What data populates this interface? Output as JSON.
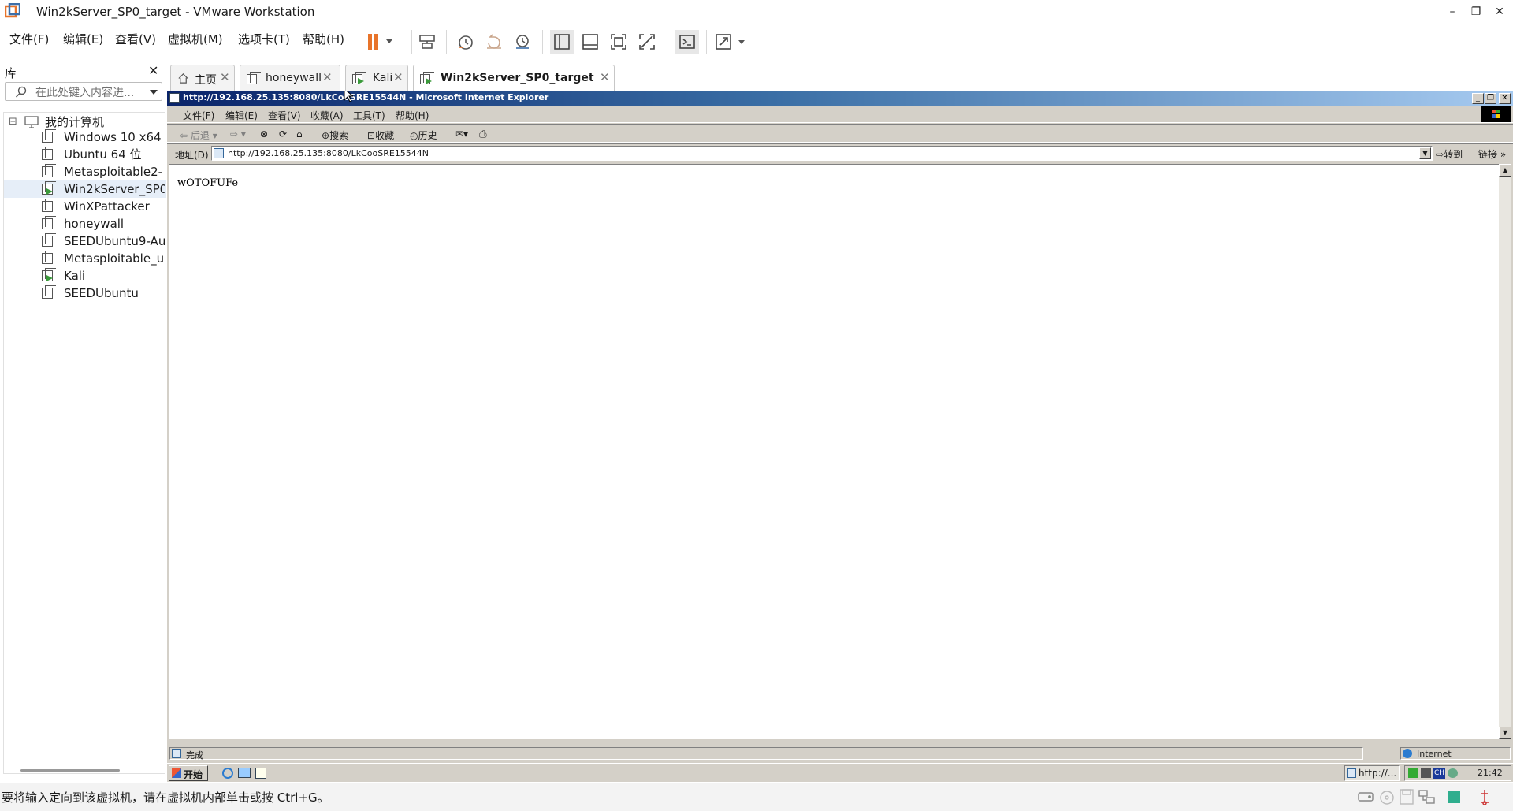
{
  "window": {
    "title": "Win2kServer_SP0_target - VMware Workstation",
    "minimize_symbol": "–",
    "restore_symbol": "❐",
    "close_symbol": "✕"
  },
  "menu": {
    "items": [
      "文件(F)",
      "编辑(E)",
      "查看(V)",
      "虚拟机(M)",
      "选项卡(T)",
      "帮助(H)"
    ]
  },
  "toolbar": {
    "icons": [
      "pause-icon",
      "send-ctrl-alt-del-icon",
      "snapshot-take-icon",
      "snapshot-revert-icon",
      "snapshot-manager-icon",
      "view-library-icon",
      "view-thumbnail-icon",
      "full-screen-icon",
      "unity-icon",
      "console-icon",
      "stretch-icon"
    ],
    "accent_color": "#e8742a"
  },
  "library": {
    "title": "库",
    "close_symbol": "✕",
    "search_placeholder": "在此处键入内容进...",
    "root": "我的计算机",
    "collapse_symbol": "⊟",
    "items": [
      {
        "label": "Windows 10 x64",
        "running": false
      },
      {
        "label": "Ubuntu 64 位",
        "running": false
      },
      {
        "label": "Metasploitable2-",
        "running": false
      },
      {
        "label": "Win2kServer_SP0",
        "running": true,
        "selected": true
      },
      {
        "label": "WinXPattacker",
        "running": false
      },
      {
        "label": "honeywall",
        "running": false
      },
      {
        "label": "SEEDUbuntu9-Au",
        "running": false
      },
      {
        "label": "Metasploitable_u",
        "running": false
      },
      {
        "label": "Kali",
        "running": true
      },
      {
        "label": "SEEDUbuntu",
        "running": false
      }
    ]
  },
  "tabs": [
    {
      "label": "主页",
      "icon": "home-icon",
      "active": false
    },
    {
      "label": "honeywall",
      "icon": "vm-icon",
      "active": false
    },
    {
      "label": "Kali",
      "icon": "vm-running-icon",
      "active": false
    },
    {
      "label": "Win2kServer_SP0_target",
      "icon": "vm-running-icon",
      "active": true
    }
  ],
  "guest": {
    "ie_title": "http://192.168.25.135:8080/LkCooSRE15544N - Microsoft Internet Explorer",
    "ie_menu": [
      "文件(F)",
      "编辑(E)",
      "查看(V)",
      "收藏(A)",
      "工具(T)",
      "帮助(H)"
    ],
    "toolbar": {
      "back": "后退",
      "search": "搜索",
      "favorites": "收藏",
      "history": "历史"
    },
    "address_label": "地址(D)",
    "address_url": "http://192.168.25.135:8080/LkCooSRE15544N",
    "go_label": "转到",
    "links_label": "链接",
    "page_text": "wOTOFUFe",
    "status_text": "完成",
    "zone_text": "Internet",
    "taskbar": {
      "start": "开始",
      "task": "http://...",
      "clock": "21:42",
      "ime": "CH"
    },
    "titlebar_color": "#0a246a"
  },
  "statusbar": {
    "message": "要将输入定向到该虚拟机，请在虚拟机内部单击或按 Ctrl+G。",
    "icons": [
      "hard-disk-icon",
      "cd-rom-icon",
      "floppy-icon",
      "network-icon",
      "sound-icon",
      "usb-icon"
    ]
  }
}
